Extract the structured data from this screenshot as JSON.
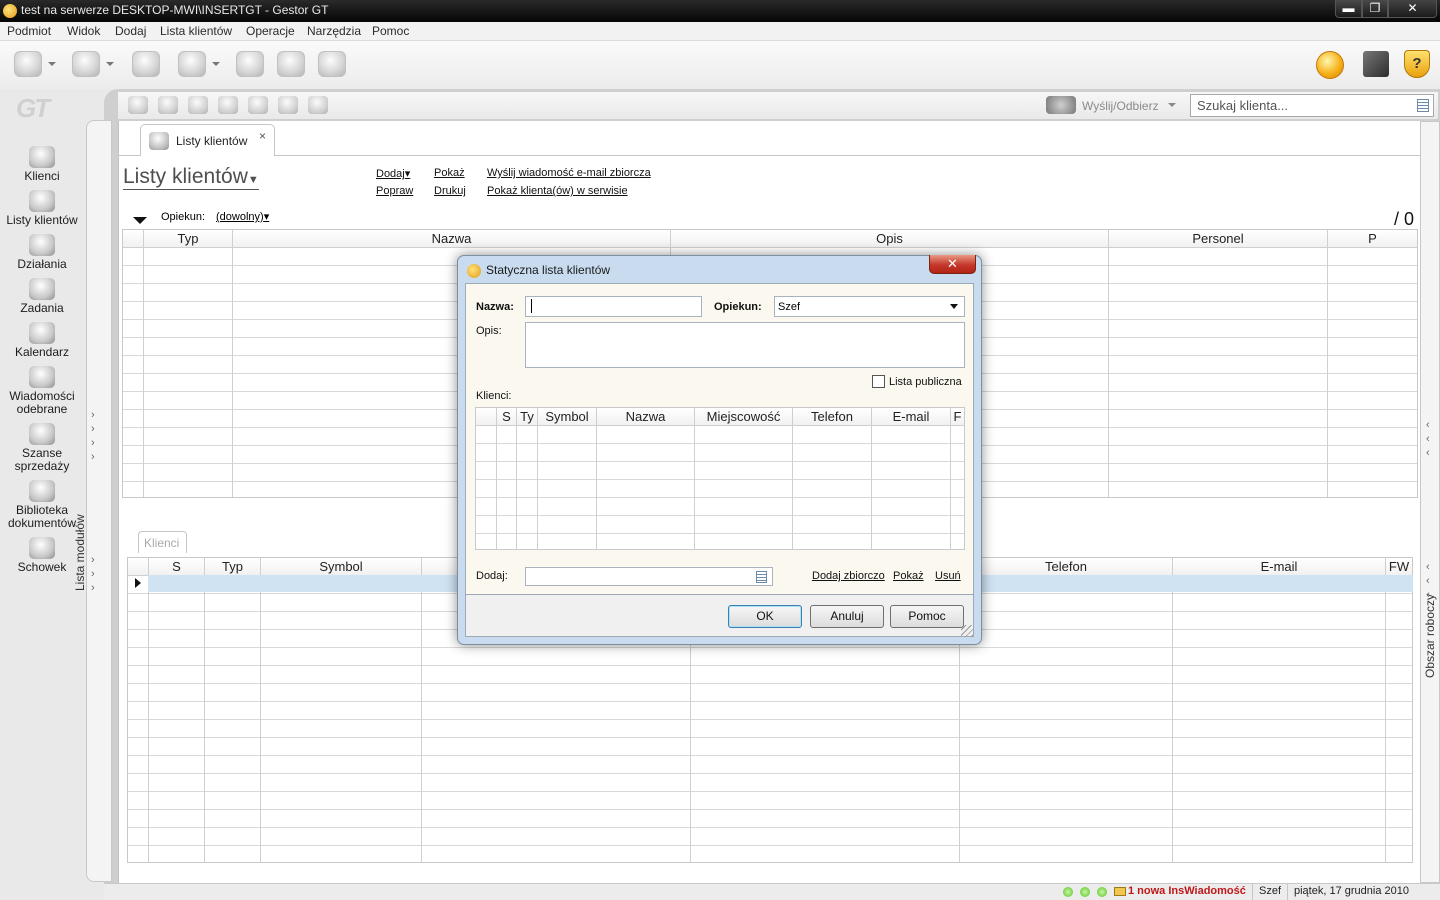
{
  "window": {
    "title": "test na serwerze DESKTOP-MWI\\INSERTGT - Gestor GT",
    "min_label": "▬",
    "max_label": "❐",
    "close_label": "✕"
  },
  "menu": [
    "Podmiot",
    "Widok",
    "Dodaj",
    "Lista klientów",
    "Operacje",
    "Narzędzia",
    "Pomoc"
  ],
  "toolbar_right": {
    "help_glyph": "?"
  },
  "logo": "GT",
  "sidebar": {
    "items": [
      {
        "label": "Klienci",
        "icon": "clients-icon"
      },
      {
        "label": "Listy klientów",
        "icon": "client-lists-icon"
      },
      {
        "label": "Działania",
        "icon": "actions-icon"
      },
      {
        "label": "Zadania",
        "icon": "tasks-icon"
      },
      {
        "label": "Kalendarz",
        "icon": "calendar-icon"
      },
      {
        "label": "Wiadomości odebrane",
        "icon": "inbox-icon"
      },
      {
        "label": "Szanse sprzedaży",
        "icon": "sales-opportunities-icon"
      },
      {
        "label": "Biblioteka dokumentów",
        "icon": "document-library-icon"
      },
      {
        "label": "Schowek",
        "icon": "clipboard-icon"
      }
    ],
    "modules_label": "Lista modułów"
  },
  "subtoolbar": {
    "send_receive": "Wyślij/Odbierz",
    "search_placeholder": "Szukaj klienta..."
  },
  "doc_tab": {
    "label": "Listy klientów",
    "close": "×"
  },
  "page": {
    "title": "Listy klientów",
    "links": {
      "dodaj": "Dodaj",
      "pokaz": "Pokaż",
      "wyslij": "Wyślij wiadomość e-mail zbiorcza",
      "popraw": "Popraw",
      "drukuj": "Drukuj",
      "pokaz_serwis": "Pokaż klienta(ów) w serwisie"
    },
    "opiekun_label": "Opiekun:",
    "opiekun_value": "(dowolny)",
    "count": "/ 0"
  },
  "grid_lists": {
    "columns": [
      "",
      "Typ",
      "Nazwa",
      "Opis",
      "Personel",
      "P"
    ]
  },
  "grid_clients": {
    "tab": "Klienci",
    "columns": [
      "",
      "S",
      "Typ",
      "Symbol",
      "",
      "",
      "Telefon",
      "E-mail",
      "FW"
    ]
  },
  "right_strip_label": "Obszar roboczy",
  "statusbar": {
    "message": "1 nowa InsWiadomość",
    "user": "Szef",
    "date": "piątek, 17 grudnia 2010"
  },
  "dialog": {
    "title": "Statyczna lista klientów",
    "close": "✕",
    "nazwa_label": "Nazwa:",
    "nazwa_value": "",
    "opiekun_label": "Opiekun:",
    "opiekun_value": "Szef",
    "opis_label": "Opis:",
    "opis_value": "",
    "lista_publiczna": "Lista publiczna",
    "lista_publiczna_checked": false,
    "klienci_label": "Klienci:",
    "grid_columns": [
      "",
      "S",
      "Ty",
      "Symbol",
      "Nazwa",
      "Miejscowość",
      "Telefon",
      "E-mail",
      "F"
    ],
    "dodaj_label": "Dodaj:",
    "dodaj_zbiorczo": "Dodaj zbiorczo",
    "pokaz": "Pokaż",
    "usun": "Usuń",
    "ok": "OK",
    "anuluj": "Anuluj",
    "pomoc": "Pomoc"
  }
}
